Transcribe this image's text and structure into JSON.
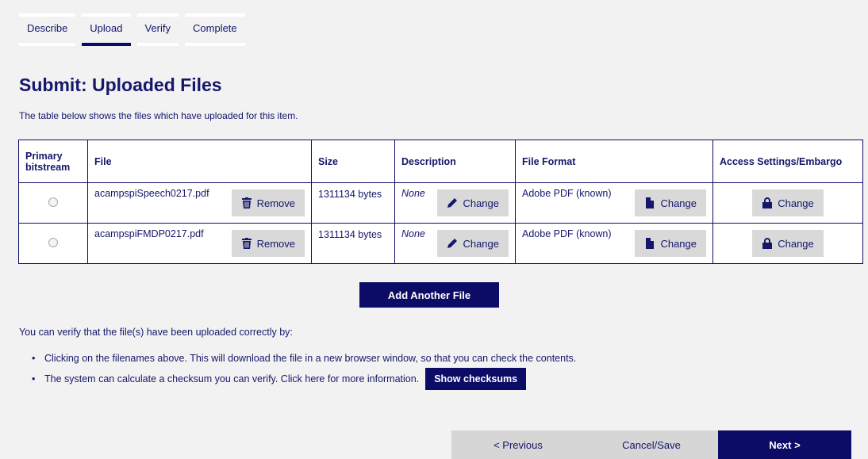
{
  "steps": [
    "Describe",
    "Upload",
    "Verify",
    "Complete"
  ],
  "active_step": "Upload",
  "title": "Submit: Uploaded Files",
  "intro": "The table below shows the files which have uploaded for this item.",
  "table": {
    "headers": {
      "primary": "Primary bitstream",
      "file": "File",
      "size": "Size",
      "description": "Description",
      "format": "File Format",
      "access": "Access Settings/Embargo"
    },
    "rows": [
      {
        "file": "acampspiSpeech0217.pdf",
        "remove": "Remove",
        "size": "1311134 bytes",
        "description": "None",
        "desc_change": "Change",
        "format": "Adobe PDF (known)",
        "format_change": "Change",
        "access_change": "Change"
      },
      {
        "file": "acampspiFMDP0217.pdf",
        "remove": "Remove",
        "size": "1311134 bytes",
        "description": "None",
        "desc_change": "Change",
        "format": "Adobe PDF (known)",
        "format_change": "Change",
        "access_change": "Change"
      }
    ]
  },
  "add_file_label": "Add Another File",
  "verify_text": "You can verify that the file(s) have been uploaded correctly by:",
  "bullets": [
    "Clicking on the filenames above. This will download the file in a new browser window, so that you can check the contents.",
    "The system can calculate a checksum you can verify. Click here for more information."
  ],
  "show_checksums_label": "Show checksums",
  "nav": {
    "previous": "< Previous",
    "cancel": "Cancel/Save",
    "next": "Next >"
  },
  "colors": {
    "primary": "#0c0c66",
    "button_gray": "#d9d9d9",
    "page_bg": "#f2f2f2"
  },
  "icons": {
    "remove": "trash-icon",
    "desc_change": "pencil-icon",
    "format_change": "file-icon",
    "access_change": "lock-icon"
  }
}
